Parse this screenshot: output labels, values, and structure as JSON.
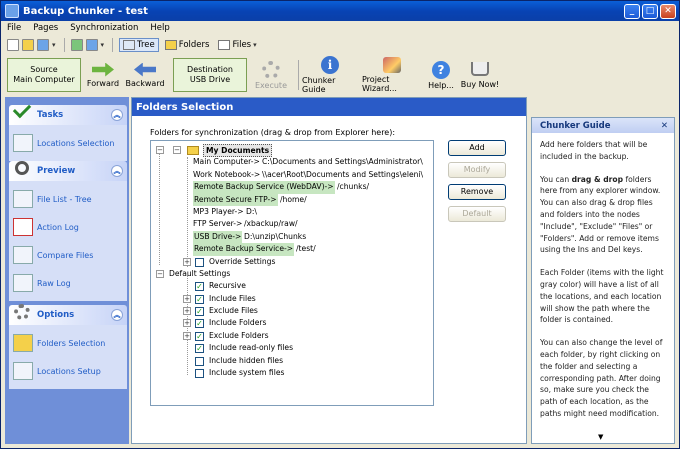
{
  "window": {
    "title": "Backup Chunker - test"
  },
  "titlebar_buttons": {
    "minimize": "_",
    "maximize": "□",
    "close": "✕"
  },
  "menu": [
    "File",
    "Pages",
    "Synchronization",
    "Help"
  ],
  "smalltoolbar": {
    "tree_label": "Tree",
    "folders_label": "Folders",
    "files_label": "Files"
  },
  "bigtoolbar": {
    "source": "Source\nMain Computer",
    "forward": "Forward",
    "backward": "Backward",
    "destination": "Destination\nUSB Drive",
    "execute": "Execute",
    "chunker_guide": "Chunker Guide",
    "project_wizard": "Project Wizard...",
    "help": "Help...",
    "buy_now": "Buy Now!"
  },
  "sidebar": {
    "tasks": {
      "title": "Tasks",
      "items": [
        "Locations Selection"
      ]
    },
    "preview": {
      "title": "Preview",
      "items": [
        "File List - Tree",
        "Action Log",
        "Compare Files",
        "Raw Log"
      ]
    },
    "options": {
      "title": "Options",
      "items": [
        "Folders Selection",
        "Locations Setup"
      ]
    }
  },
  "main": {
    "title": "Folders Selection",
    "instruction": "Folders for synchronization (drag & drop from Explorer here):",
    "tree": {
      "root": "My Documents",
      "locations": [
        {
          "name": "Main Computer->",
          "path": "C:\\Documents and Settings\\Administrator\\",
          "remote": false
        },
        {
          "name": "Work Notebook->",
          "path": "\\\\acer\\Root\\Documents and Settings\\eleni\\",
          "remote": false
        },
        {
          "name": "Remote Backup Service (WebDAV)->",
          "path": "/chunks/",
          "remote": true
        },
        {
          "name": "Remote Secure FTP->",
          "path": "/home/",
          "remote": true
        },
        {
          "name": "MP3 Player->",
          "path": "D:\\",
          "remote": false
        },
        {
          "name": "FTP Server->",
          "path": "/xbackup/raw/",
          "remote": false
        },
        {
          "name": "USB Drive->",
          "path": "D:\\unzip\\Chunks",
          "remote": true
        },
        {
          "name": "Remote Backup Service->",
          "path": "/test/",
          "remote": true
        }
      ],
      "override": "Override Settings",
      "default_settings": "Default Settings",
      "settings": [
        {
          "label": "Recursive",
          "checked": true,
          "expander": false
        },
        {
          "label": "Include Files",
          "checked": true,
          "expander": true
        },
        {
          "label": "Exclude Files",
          "checked": true,
          "expander": true
        },
        {
          "label": "Include Folders",
          "checked": true,
          "expander": true
        },
        {
          "label": "Exclude Folders",
          "checked": true,
          "expander": true
        },
        {
          "label": "Include read-only files",
          "checked": true,
          "expander": false
        },
        {
          "label": "Include hidden files",
          "checked": false,
          "expander": false
        },
        {
          "label": "Include system files",
          "checked": false,
          "expander": false
        }
      ]
    },
    "buttons": {
      "add": "Add",
      "modify": "Modify",
      "remove": "Remove",
      "default": "Default"
    }
  },
  "guide": {
    "title": "Chunker Guide",
    "close": "✕",
    "p1": "Add here folders that will be included in the backup.",
    "p2_pre": "You can ",
    "p2_bold": "drag & drop",
    "p2_post": " folders here from any explorer window. You can also drag & drop files and folders into the nodes \"Include\", \"Exclude\" \"Files\" or \"Folders\". Add or remove items using the  Ins and Del keys.",
    "p3": "Each Folder (items with the light gray color) will have a list of all the locations, and each location will show the path where the folder is contained.",
    "p4": "You can also change the level of each folder, by right clicking on the folder and selecting a corresponding path. After doing so, make sure you check the path of each location, as the paths might need modification.",
    "scroll": "▼"
  }
}
